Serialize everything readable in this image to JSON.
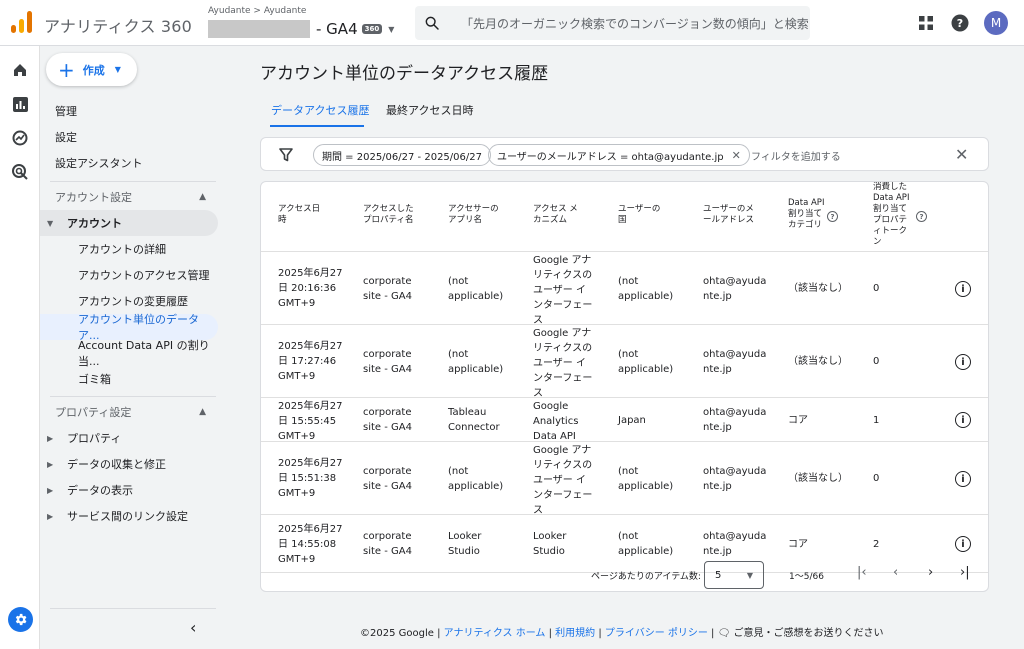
{
  "app": {
    "name": "アナリティクス 360"
  },
  "property": {
    "account": "Ayudante > Ayudante",
    "name": "- GA4",
    "badge": "360"
  },
  "search": {
    "placeholder": "「先月のオーガニック検索でのコンバージョン数の傾向」と検索..."
  },
  "user": {
    "initial": "M"
  },
  "sidebar": {
    "create_label": "作成",
    "top_items": [
      "管理",
      "設定",
      "設定アシスタント"
    ],
    "account_section": "アカウント設定",
    "account_group": "アカウント",
    "account_items": [
      "アカウントの詳細",
      "アカウントのアクセス管理",
      "アカウントの変更履歴",
      "アカウント単位のデータア...",
      "Account Data API の割り当...",
      "ゴミ箱"
    ],
    "property_section": "プロパティ設定",
    "property_items": [
      "プロパティ",
      "データの収集と修正",
      "データの表示",
      "サービス間のリンク設定"
    ]
  },
  "page": {
    "title": "アカウント単位のデータアクセス履歴",
    "tabs": [
      "データアクセス履歴",
      "最終アクセス日時"
    ]
  },
  "filters": {
    "chips": [
      "期間 = 2025/06/27 - 2025/06/27",
      "ユーザーのメールアドレス = ohta@ayudante.jp"
    ],
    "add_label": "フィルタを追加する"
  },
  "table": {
    "headers": [
      "アクセス日\n時",
      "アクセスした\nプロパティ名",
      "アクセサーの\nアプリ名",
      "アクセス メ\nカニズム",
      "ユーザーの\n国",
      "ユーザーのメ\nールアドレス",
      "Data API\n割り当て\nカテゴリ",
      "消費した\nData API\n割り当て\nプロパテ\nィトーク\nン"
    ],
    "rows": [
      [
        "2025年6月27\n日 20:16:36\nGMT+9",
        "corporate\nsite - GA4",
        "(not\napplicable)",
        "Google アナ\nリティクスの\nユーザー イ\nンターフェー\nス",
        "(not\napplicable)",
        "ohta@ayuda\nnte.jp",
        "（該当なし）",
        "0"
      ],
      [
        "2025年6月27\n日 17:27:46\nGMT+9",
        "corporate\nsite - GA4",
        "(not\napplicable)",
        "Google アナ\nリティクスの\nユーザー イ\nンターフェー\nス",
        "(not\napplicable)",
        "ohta@ayuda\nnte.jp",
        "（該当なし）",
        "0"
      ],
      [
        "2025年6月27\n日 15:55:45\nGMT+9",
        "corporate\nsite - GA4",
        "Tableau\nConnector",
        "Google\nAnalytics\nData API",
        "Japan",
        "ohta@ayuda\nnte.jp",
        "コア",
        "1"
      ],
      [
        "2025年6月27\n日 15:51:38\nGMT+9",
        "corporate\nsite - GA4",
        "(not\napplicable)",
        "Google アナ\nリティクスの\nユーザー イ\nンターフェー\nス",
        "(not\napplicable)",
        "ohta@ayuda\nnte.jp",
        "（該当なし）",
        "0"
      ],
      [
        "2025年6月27\n日 14:55:08\nGMT+9",
        "corporate\nsite - GA4",
        "Looker\nStudio",
        "Looker\nStudio",
        "(not\napplicable)",
        "ohta@ayuda\nnte.jp",
        "コア",
        "2"
      ]
    ]
  },
  "pagination": {
    "label": "ページあたりのアイテム数:",
    "page_size": "5",
    "range": "1〜5/66"
  },
  "footer": {
    "copyright": "©2025 Google |",
    "links": [
      "アナリティクス ホーム",
      "利用規約",
      "プライバシー ポリシー"
    ],
    "feedback": "ご意見・ご感想をお送りください"
  }
}
